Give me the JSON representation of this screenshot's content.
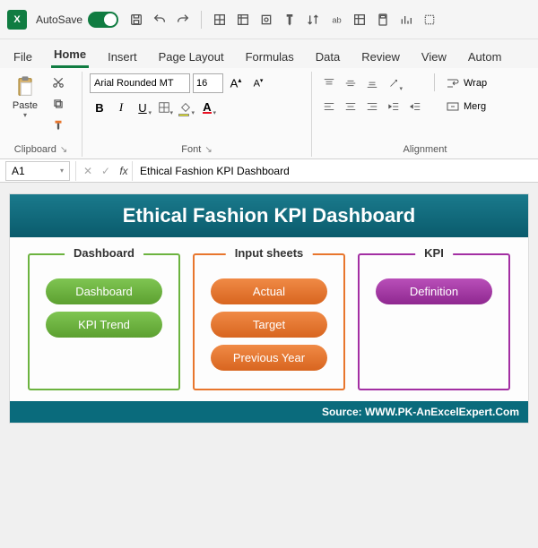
{
  "titlebar": {
    "autosave_label": "AutoSave",
    "autosave_state": "On"
  },
  "tabs": {
    "file": "File",
    "home": "Home",
    "insert": "Insert",
    "pagelayout": "Page Layout",
    "formulas": "Formulas",
    "data": "Data",
    "review": "Review",
    "view": "View",
    "automate": "Autom"
  },
  "ribbon": {
    "clipboard_label": "Clipboard",
    "paste_label": "Paste",
    "font_label": "Font",
    "font_name": "Arial Rounded MT",
    "font_size": "16",
    "alignment_label": "Alignment",
    "wrap_label": "Wrap",
    "merge_label": "Merg"
  },
  "formula": {
    "cell_ref": "A1",
    "fx": "fx",
    "value": "Ethical Fashion KPI Dashboard"
  },
  "dashboard": {
    "title": "Ethical Fashion KPI Dashboard",
    "panels": {
      "dashboard": {
        "title": "Dashboard",
        "items": [
          "Dashboard",
          "KPI Trend"
        ]
      },
      "input": {
        "title": "Input sheets",
        "items": [
          "Actual",
          "Target",
          "Previous Year"
        ]
      },
      "kpi": {
        "title": "KPI",
        "items": [
          "Definition"
        ]
      }
    },
    "source": "Source: WWW.PK-AnExcelExpert.Com"
  }
}
